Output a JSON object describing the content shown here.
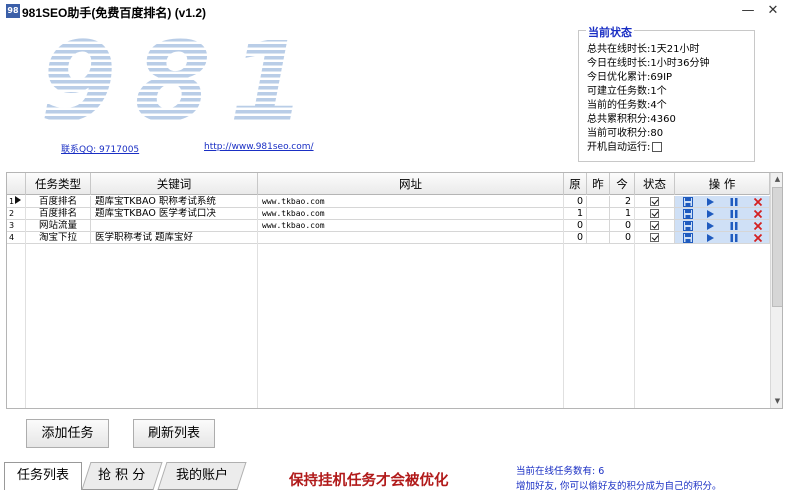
{
  "window": {
    "title": "981SEO助手(免费百度排名) (v1.2)",
    "icon_text": "98",
    "minimize_glyph": "—",
    "close_glyph": "✕"
  },
  "logo": {
    "text": "981",
    "qq_link": "联系QQ: 9717005",
    "site_link": "http://www.981seo.com/"
  },
  "status": {
    "title": "当前状态",
    "rows": [
      {
        "label": "总共在线时长:",
        "value": "1天21小时"
      },
      {
        "label": "今日在线时长:",
        "value": "1小时36分钟"
      },
      {
        "label": "今日优化累计:",
        "value": "69IP"
      },
      {
        "label": "可建立任务数:",
        "value": "1个"
      },
      {
        "label": "当前的任务数:",
        "value": "4个"
      },
      {
        "label": "总共累积积分:",
        "value": "4360"
      },
      {
        "label": "当前可收积分:",
        "value": "80"
      }
    ],
    "autorun_label": "开机自动运行:",
    "autorun_checked": false
  },
  "table": {
    "columns": [
      "任务类型",
      "关键词",
      "网址",
      "原",
      "昨",
      "今",
      "状态",
      "操 作"
    ],
    "rows": [
      {
        "num": "1",
        "selected": true,
        "type": "百度排名",
        "keyword": "题库宝TKBAO 职称考试系统",
        "url": "www.tkbao.com",
        "orig": "0",
        "yest": "",
        "today": "2",
        "checked": true
      },
      {
        "num": "2",
        "selected": false,
        "type": "百度排名",
        "keyword": "题库宝TKBAO 医学考试口决",
        "url": "www.tkbao.com",
        "orig": "1",
        "yest": "",
        "today": "1",
        "checked": true
      },
      {
        "num": "3",
        "selected": false,
        "type": "网站流量",
        "keyword": "",
        "url": "www.tkbao.com",
        "orig": "0",
        "yest": "",
        "today": "0",
        "checked": true
      },
      {
        "num": "4",
        "selected": false,
        "type": "淘宝下拉",
        "keyword": "医学职称考试  题库宝好",
        "url": "",
        "orig": "0",
        "yest": "",
        "today": "0",
        "checked": true
      }
    ],
    "op_icons": [
      "save-icon",
      "play-icon",
      "pause-icon",
      "delete-icon"
    ]
  },
  "buttons": {
    "add_task": "添加任务",
    "refresh_list": "刷新列表"
  },
  "tabs": [
    {
      "label": "任务列表",
      "active": true
    },
    {
      "label": "抢 积 分",
      "active": false
    },
    {
      "label": "我的账户",
      "active": false
    }
  ],
  "footer": {
    "slogan": "保持挂机任务才会被优化",
    "online_tasks": "当前在线任务数有: 6",
    "invite_tip": "增加好友, 你可以偷好友的积分成为自己的积分。"
  },
  "colors": {
    "accent_blue": "#1a2fc4",
    "slogan_red": "#b11a1a",
    "ops_bg": "#cfe0f6",
    "op_icon_blue": "#1f5bbf",
    "delete_red": "#d42020",
    "logo_blue": "#b9cde7"
  }
}
